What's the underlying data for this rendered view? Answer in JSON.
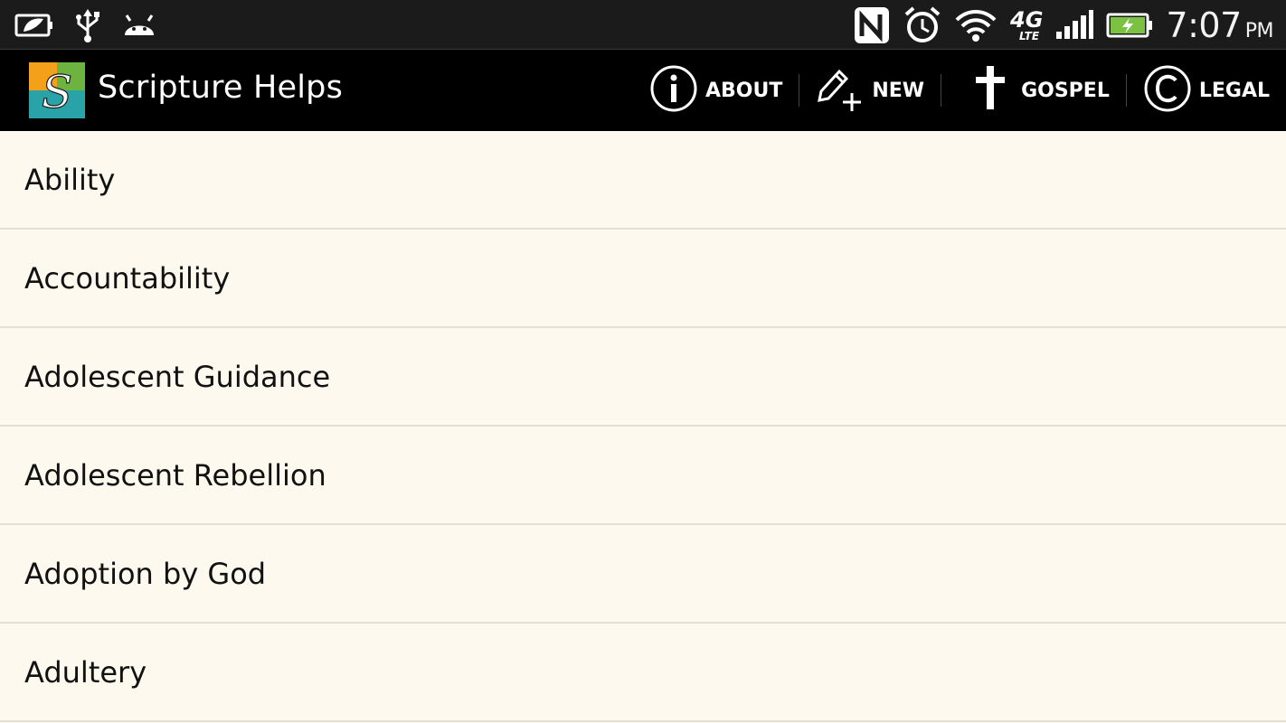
{
  "status_bar": {
    "time": "7:07",
    "ampm": "PM",
    "network": "4G",
    "network_sub": "LTE",
    "icons": [
      "power-saver-icon",
      "usb-icon",
      "android-debug-icon",
      "nfc-icon",
      "alarm-icon",
      "wifi-icon",
      "signal-icon",
      "battery-charging-icon"
    ]
  },
  "action_bar": {
    "title": "Scripture Helps",
    "logo_letter": "S",
    "actions": [
      {
        "label": "ABOUT",
        "icon": "info-icon"
      },
      {
        "label": "NEW",
        "icon": "new-note-icon"
      },
      {
        "label": "GOSPEL",
        "icon": "cross-icon"
      },
      {
        "label": "LEGAL",
        "icon": "copyright-icon"
      }
    ]
  },
  "topics": [
    "Ability",
    "Accountability",
    "Adolescent Guidance",
    "Adolescent Rebellion",
    "Adoption by God",
    "Adultery"
  ],
  "colors": {
    "background": "#fdf9ee",
    "action_bar": "#000000",
    "status_bar": "#1b1b1b",
    "battery_fill": "#7bc142",
    "logo_orange": "#f3a01b",
    "logo_green": "#6cb33f",
    "logo_teal": "#2aa3a8"
  }
}
